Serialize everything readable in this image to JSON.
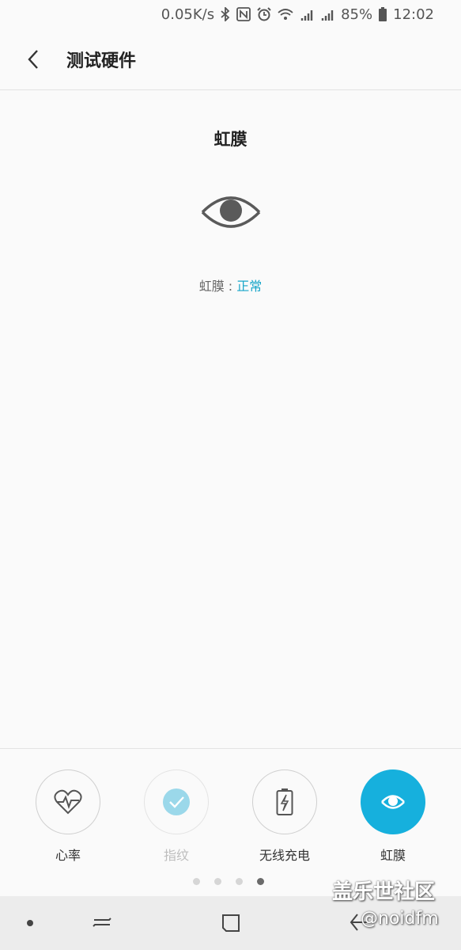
{
  "status_bar": {
    "net_speed": "0.05K/s",
    "battery": "85%",
    "time": "12:02",
    "icons": [
      "bluetooth-icon",
      "nfc-icon",
      "alarm-icon",
      "wifi-icon",
      "signal-4g-icon",
      "signal-4g-icon",
      "battery-icon"
    ]
  },
  "app_bar": {
    "title": "测试硬件"
  },
  "main": {
    "title": "虹膜",
    "status_label": "虹膜 : ",
    "status_value": "正常",
    "status_color": "#18a6c9",
    "icon": "eye-icon"
  },
  "tabs": [
    {
      "label": "心率",
      "icon": "heart-rate-icon",
      "state": "normal"
    },
    {
      "label": "指纹",
      "icon": "check-icon",
      "state": "disabled"
    },
    {
      "label": "无线充电",
      "icon": "battery-charge-icon",
      "state": "normal"
    },
    {
      "label": "虹膜",
      "icon": "eye-icon",
      "state": "active"
    }
  ],
  "pager": {
    "count": 4,
    "current": 4
  },
  "colors": {
    "accent": "#16b0dd",
    "background": "#fafafa"
  },
  "watermark": {
    "line1": "盖乐世社区",
    "line2": "@noidfm"
  }
}
